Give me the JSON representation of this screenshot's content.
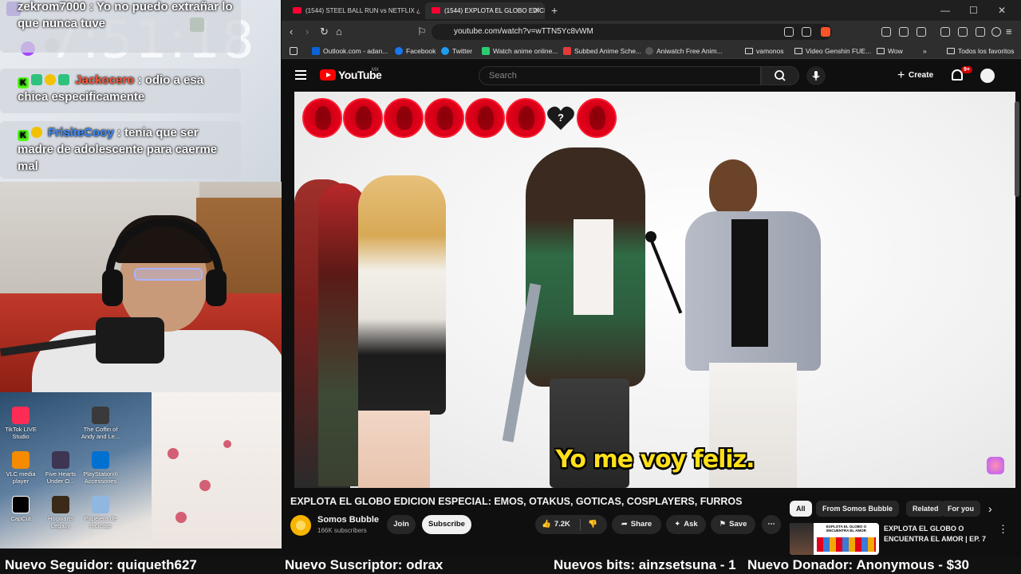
{
  "stream": {
    "chat": [
      {
        "user": "zekrom7000",
        "text": ": Yo no puedo extrañar lo que nunca tuve"
      },
      {
        "user": "Jackocero",
        "text": ": odio a esa chica especificamente"
      },
      {
        "user": "FrisiteCooy",
        "text": ": tenia que ser madre de adolescente para caerme mal"
      }
    ],
    "background_clock": "7:51:18",
    "desktop_icons": [
      {
        "label": "TikTok LIVE Studio"
      },
      {
        "label": "The Coffin of Andy and Le..."
      },
      {
        "label": "VLC media player"
      },
      {
        "label": "Five Hearts Under O..."
      },
      {
        "label": "PlayStation® Accessories"
      },
      {
        "label": "CapCut"
      },
      {
        "label": "Hogwarts Legacy"
      },
      {
        "label": "Papelera de reciclaje"
      }
    ],
    "ticker": [
      {
        "text": "Nuevo Seguidor: quiqueth627"
      },
      {
        "text": "Nuevo Suscriptor: odrax"
      },
      {
        "text": "Nuevos bits: ainzsetsuna - 1"
      },
      {
        "text": "Nuevo Donador: Anonymous - $30"
      }
    ]
  },
  "browser": {
    "tabs": [
      {
        "label": "(1544) STEEL BALL RUN vs NETFLIX ¿",
        "active": false
      },
      {
        "label": "(1544) EXPLOTA EL GLOBO EDICI",
        "active": true
      }
    ],
    "url": "youtube.com/watch?v=wTTN5Yc8vWM",
    "bookmarks": [
      {
        "label": "Outlook.com - adan...",
        "color": "#0a64d6"
      },
      {
        "label": "Facebook",
        "color": "#1877f2"
      },
      {
        "label": "Twitter",
        "color": "#1d9bf0"
      },
      {
        "label": "Watch anime online...",
        "color": "#2ecc71"
      },
      {
        "label": "Subbed Anime Sche...",
        "color": "#e23b3b"
      },
      {
        "label": "Aniwatch Free Anim...",
        "color": "#2a2a2a"
      },
      {
        "label": "vamonos",
        "color": "folder"
      },
      {
        "label": "Video Genshin FUE...",
        "color": "folder"
      },
      {
        "label": "Wow",
        "color": "folder"
      }
    ],
    "bookmarks_all": "Todos los favoritos"
  },
  "youtube": {
    "brand": "YouTube",
    "region": "MX",
    "search_placeholder": "Search",
    "create_label": "Create",
    "notifications": "9+",
    "subtitle": "Yo me voy feliz.",
    "video_title": "EXPLOTA EL GLOBO EDICION ESPECIAL: EMOS, OTAKUS, GOTICAS, COSPLAYERS, FURROS",
    "channel_name": "Somos Bubble",
    "channel_subs": "166K subscribers",
    "join_label": "Join",
    "subscribe_label": "Subscribe",
    "likes": "7.2K",
    "share_label": "Share",
    "ask_label": "Ask",
    "save_label": "Save",
    "chips": [
      "All",
      "From Somos Bubble",
      "Related",
      "For you"
    ],
    "recommendation": {
      "title": "EXPLOTA EL GLOBO O ENCUENTRA EL AMOR | EP. 7",
      "thumb_text": "EXPLOTA EL GLOBO O ENCUENTRA EL AMOR"
    },
    "accent_color": "#ff0000"
  }
}
